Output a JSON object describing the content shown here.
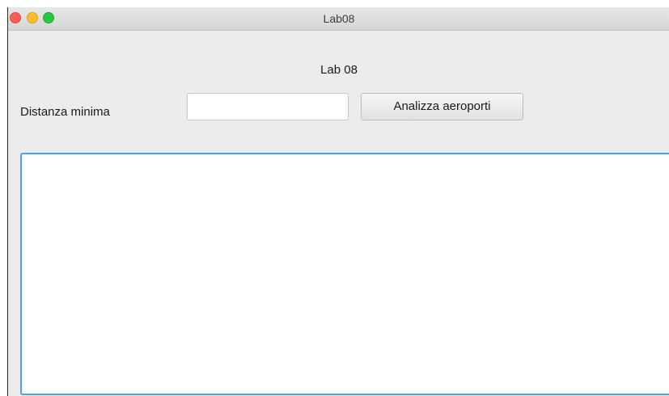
{
  "window": {
    "title": "Lab08"
  },
  "main": {
    "heading": "Lab 08",
    "distance_label": "Distanza minima",
    "distance_input_value": "",
    "analyze_button_label": "Analizza aeroporti",
    "output_text": ""
  },
  "colors": {
    "close": "#fc5f57",
    "minimize": "#fdbc2e",
    "maximize": "#28c840",
    "focus_border": "#49a8e0"
  }
}
